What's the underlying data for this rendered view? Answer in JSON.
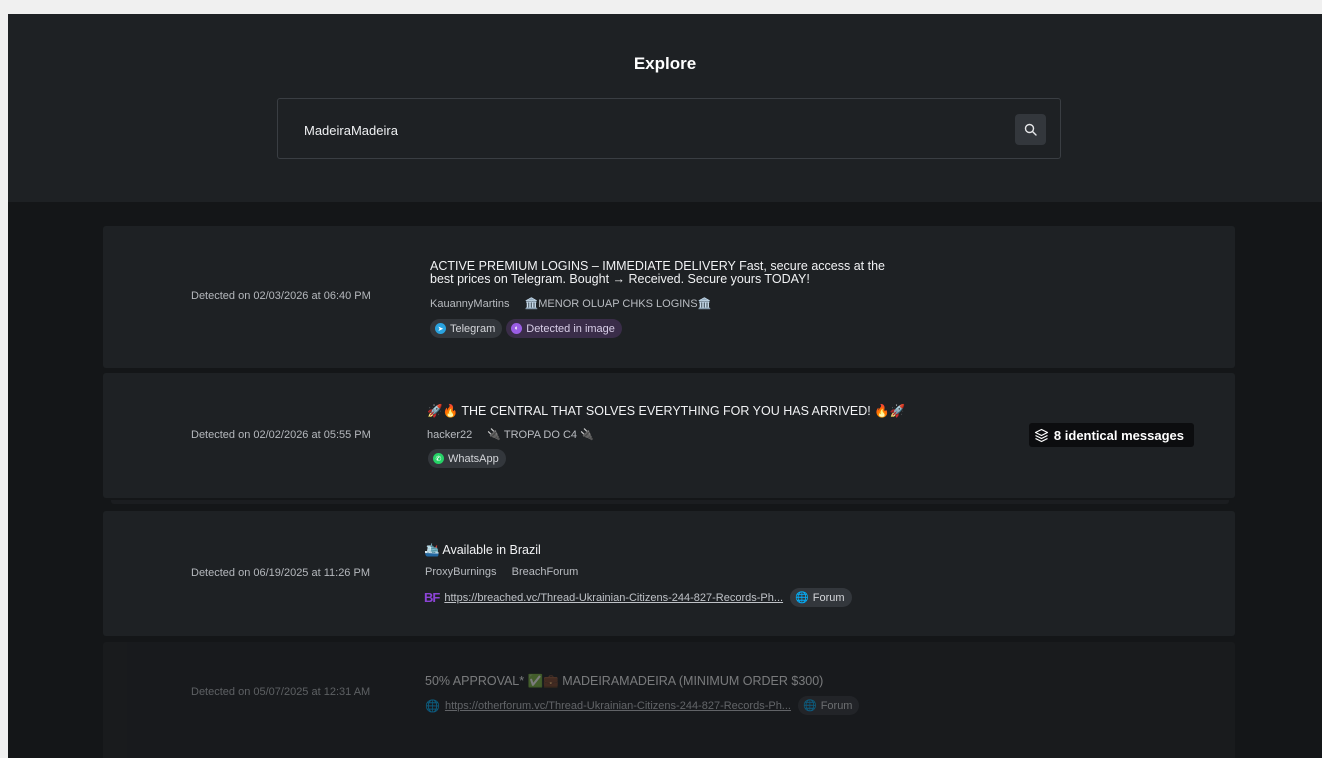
{
  "header": {
    "title": "Explore"
  },
  "search": {
    "value": "MadeiraMadeira",
    "button_icon": "search-icon"
  },
  "results": [
    {
      "date": "Detected on 02/03/2026 at 06:40 PM",
      "message_line1": "ACTIVE PREMIUM LOGINS – IMMEDIATE DELIVERY Fast, secure access at the",
      "message_line2": "best prices on Telegram. Bought → Received. Secure yours TODAY!",
      "author": "KauannyMartins",
      "channel": "🏛️MENOR OLUAP CHKS LOGINS🏛️",
      "tags": [
        "Telegram",
        "Detected in image"
      ]
    },
    {
      "date": "Detected on 02/02/2026 at 05:55 PM",
      "message": "🚀🔥 THE CENTRAL THAT SOLVES EVERYTHING FOR YOU HAS ARRIVED! 🔥🚀",
      "author": "hacker22",
      "channel": "🔌 TROPA DO C4 🔌",
      "tags": [
        "WhatsApp"
      ],
      "identical": "8 identical messages"
    },
    {
      "date": "Detected on 06/19/2025 at 11:26 PM",
      "message": "🛳️ Available in Brazil",
      "author": "ProxyBurnings",
      "channel": "BreachForum",
      "logo": "BF",
      "link": "https://breached.vc/Thread-Ukrainian-Citizens-244-827-Records-Ph...",
      "tag": "Forum"
    },
    {
      "date": "Detected on 05/07/2025 at 12:31 AM",
      "message": "50% APPROVAL* ✅💼 MADEIRAMADEIRA (MINIMUM ORDER $300)",
      "link": "https://otherforum.vc/Thread-Ukrainian-Citizens-244-827-Records-Ph...",
      "tag": "Forum"
    }
  ],
  "colors": {
    "background": "#141618",
    "card": "#1e2124",
    "accent_purple": "#8c44d6",
    "telegram": "#2aa3df",
    "whatsapp": "#25d366"
  }
}
